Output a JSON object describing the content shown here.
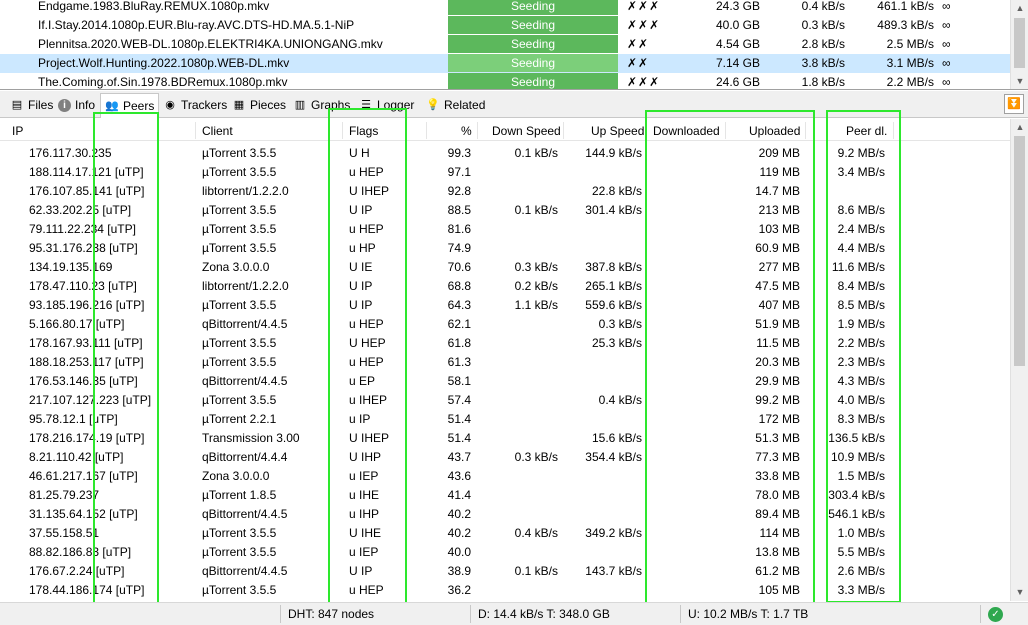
{
  "torrents": [
    {
      "name": "Endgame.1983.BluRay.REMUX.1080p.mkv",
      "status": "Seeding",
      "checks": "✗✗✗",
      "size": "24.3 GB",
      "up_speed": "0.4 kB/s",
      "down_speed": "461.1 kB/s",
      "eta": "∞"
    },
    {
      "name": "If.I.Stay.2014.1080p.EUR.Blu-ray.AVC.DTS-HD.MA.5.1-NiP",
      "status": "Seeding",
      "checks": "✗✗✗",
      "size": "40.0 GB",
      "up_speed": "0.3 kB/s",
      "down_speed": "489.3 kB/s",
      "eta": "∞"
    },
    {
      "name": "Plennitsa.2020.WEB-DL.1080p.ELEKTRI4KA.UNIONGANG.mkv",
      "status": "Seeding",
      "checks": "✗✗",
      "size": "4.54 GB",
      "up_speed": "2.8 kB/s",
      "down_speed": "2.5 MB/s",
      "eta": "∞"
    },
    {
      "name": "Project.Wolf.Hunting.2022.1080p.WEB-DL.mkv",
      "status": "Seeding",
      "checks": "✗✗",
      "size": "7.14 GB",
      "up_speed": "3.8 kB/s",
      "down_speed": "3.1 MB/s",
      "eta": "∞",
      "selected": true
    },
    {
      "name": "The.Coming.of.Sin.1978.BDRemux.1080p.mkv",
      "status": "Seeding",
      "checks": "✗✗✗",
      "size": "24.6 GB",
      "up_speed": "1.8 kB/s",
      "down_speed": "2.2 MB/s",
      "eta": "∞"
    }
  ],
  "tabs": [
    {
      "label": "Files",
      "icon": "file-icon"
    },
    {
      "label": "Info",
      "icon": "info-icon"
    },
    {
      "label": "Peers",
      "icon": "peers-icon",
      "active": true
    },
    {
      "label": "Trackers",
      "icon": "tracker-icon"
    },
    {
      "label": "Pieces",
      "icon": "pieces-icon"
    },
    {
      "label": "Graphs",
      "icon": "graph-icon"
    },
    {
      "label": "Logger",
      "icon": "logger-icon"
    },
    {
      "label": "Related",
      "icon": "bulb-icon"
    }
  ],
  "peer_columns": {
    "ip": "IP",
    "client": "Client",
    "flags": "Flags",
    "pct": "%",
    "down_speed": "Down Speed",
    "up_speed": "Up Speed",
    "downloaded": "Downloaded",
    "uploaded": "Uploaded",
    "peer_dl": "Peer dl."
  },
  "peers": [
    {
      "ip": "176.117.30.235",
      "client": "µTorrent 3.5.5",
      "flags": "U H",
      "pct": "99.3",
      "down": "0.1 kB/s",
      "up": "144.9 kB/s",
      "dl": "",
      "ul": "209 MB",
      "peer_dl": "9.2 MB/s"
    },
    {
      "ip": "188.114.17.121 [uTP]",
      "client": "µTorrent 3.5.5",
      "flags": "u HEP",
      "pct": "97.1",
      "down": "",
      "up": "",
      "dl": "",
      "ul": "119 MB",
      "peer_dl": "3.4 MB/s"
    },
    {
      "ip": "176.107.85.141 [uTP]",
      "client": "libtorrent/1.2.2.0",
      "flags": "U IHEP",
      "pct": "92.8",
      "down": "",
      "up": "22.8 kB/s",
      "dl": "",
      "ul": "14.7 MB",
      "peer_dl": ""
    },
    {
      "ip": "62.33.202.25 [uTP]",
      "client": "µTorrent 3.5.5",
      "flags": "U IP",
      "pct": "88.5",
      "down": "0.1 kB/s",
      "up": "301.4 kB/s",
      "dl": "",
      "ul": "213 MB",
      "peer_dl": "8.6 MB/s"
    },
    {
      "ip": "79.111.22.234 [uTP]",
      "client": "µTorrent 3.5.5",
      "flags": "u HEP",
      "pct": "81.6",
      "down": "",
      "up": "",
      "dl": "",
      "ul": "103 MB",
      "peer_dl": "2.4 MB/s"
    },
    {
      "ip": "95.31.176.238 [uTP]",
      "client": "µTorrent 3.5.5",
      "flags": "u HP",
      "pct": "74.9",
      "down": "",
      "up": "",
      "dl": "",
      "ul": "60.9 MB",
      "peer_dl": "4.4 MB/s"
    },
    {
      "ip": "134.19.135.169",
      "client": "Zona 3.0.0.0",
      "flags": "U IE",
      "pct": "70.6",
      "down": "0.3 kB/s",
      "up": "387.8 kB/s",
      "dl": "",
      "ul": "277 MB",
      "peer_dl": "11.6 MB/s"
    },
    {
      "ip": "178.47.110.23 [uTP]",
      "client": "libtorrent/1.2.2.0",
      "flags": "U IP",
      "pct": "68.8",
      "down": "0.2 kB/s",
      "up": "265.1 kB/s",
      "dl": "",
      "ul": "47.5 MB",
      "peer_dl": "8.4 MB/s"
    },
    {
      "ip": "93.185.196.216 [uTP]",
      "client": "µTorrent 3.5.5",
      "flags": "U IP",
      "pct": "64.3",
      "down": "1.1 kB/s",
      "up": "559.6 kB/s",
      "dl": "",
      "ul": "407 MB",
      "peer_dl": "8.5 MB/s"
    },
    {
      "ip": "5.166.80.17 [uTP]",
      "client": "qBittorrent/4.4.5",
      "flags": "u HEP",
      "pct": "62.1",
      "down": "",
      "up": "0.3 kB/s",
      "dl": "",
      "ul": "51.9 MB",
      "peer_dl": "1.9 MB/s"
    },
    {
      "ip": "178.167.93.111 [uTP]",
      "client": "µTorrent 3.5.5",
      "flags": "U HEP",
      "pct": "61.8",
      "down": "",
      "up": "25.3 kB/s",
      "dl": "",
      "ul": "11.5 MB",
      "peer_dl": "2.2 MB/s"
    },
    {
      "ip": "188.18.253.117 [uTP]",
      "client": "µTorrent 3.5.5",
      "flags": "u HEP",
      "pct": "61.3",
      "down": "",
      "up": "",
      "dl": "",
      "ul": "20.3 MB",
      "peer_dl": "2.3 MB/s"
    },
    {
      "ip": "176.53.146.35 [uTP]",
      "client": "qBittorrent/4.4.5",
      "flags": "u EP",
      "pct": "58.1",
      "down": "",
      "up": "",
      "dl": "",
      "ul": "29.9 MB",
      "peer_dl": "4.3 MB/s"
    },
    {
      "ip": "217.107.127.223 [uTP]",
      "client": "µTorrent 3.5.5",
      "flags": "u IHEP",
      "pct": "57.4",
      "down": "",
      "up": "0.4 kB/s",
      "dl": "",
      "ul": "99.2 MB",
      "peer_dl": "4.0 MB/s"
    },
    {
      "ip": "95.78.12.1 [uTP]",
      "client": "µTorrent 2.2.1",
      "flags": "u IP",
      "pct": "51.4",
      "down": "",
      "up": "",
      "dl": "",
      "ul": "172 MB",
      "peer_dl": "8.3 MB/s"
    },
    {
      "ip": "178.216.174.19 [uTP]",
      "client": "Transmission 3.00",
      "flags": "U IHEP",
      "pct": "51.4",
      "down": "",
      "up": "15.6 kB/s",
      "dl": "",
      "ul": "51.3 MB",
      "peer_dl": "136.5 kB/s"
    },
    {
      "ip": "8.21.110.42 [uTP]",
      "client": "qBittorrent/4.4.4",
      "flags": "U IHP",
      "pct": "43.7",
      "down": "0.3 kB/s",
      "up": "354.4 kB/s",
      "dl": "",
      "ul": "77.3 MB",
      "peer_dl": "10.9 MB/s"
    },
    {
      "ip": "46.61.217.167 [uTP]",
      "client": "Zona 3.0.0.0",
      "flags": "u IEP",
      "pct": "43.6",
      "down": "",
      "up": "",
      "dl": "",
      "ul": "33.8 MB",
      "peer_dl": "1.5 MB/s"
    },
    {
      "ip": "81.25.79.237",
      "client": "µTorrent 1.8.5",
      "flags": "u IHE",
      "pct": "41.4",
      "down": "",
      "up": "",
      "dl": "",
      "ul": "78.0 MB",
      "peer_dl": "303.4 kB/s"
    },
    {
      "ip": "31.135.64.152 [uTP]",
      "client": "qBittorrent/4.4.5",
      "flags": "u IHP",
      "pct": "40.2",
      "down": "",
      "up": "",
      "dl": "",
      "ul": "89.4 MB",
      "peer_dl": "546.1 kB/s"
    },
    {
      "ip": "37.55.158.51",
      "client": "µTorrent 3.5.5",
      "flags": "U IHE",
      "pct": "40.2",
      "down": "0.4 kB/s",
      "up": "349.2 kB/s",
      "dl": "",
      "ul": "114 MB",
      "peer_dl": "1.0 MB/s"
    },
    {
      "ip": "88.82.186.83 [uTP]",
      "client": "µTorrent 3.5.5",
      "flags": "u IEP",
      "pct": "40.0",
      "down": "",
      "up": "",
      "dl": "",
      "ul": "13.8 MB",
      "peer_dl": "5.5 MB/s"
    },
    {
      "ip": "176.67.2.24 [uTP]",
      "client": "qBittorrent/4.4.5",
      "flags": "U IP",
      "pct": "38.9",
      "down": "0.1 kB/s",
      "up": "143.7 kB/s",
      "dl": "",
      "ul": "61.2 MB",
      "peer_dl": "2.6 MB/s"
    },
    {
      "ip": "178.44.186.174 [uTP]",
      "client": "µTorrent 3.5.5",
      "flags": "u HEP",
      "pct": "36.2",
      "down": "",
      "up": "",
      "dl": "",
      "ul": "105 MB",
      "peer_dl": "3.3 MB/s"
    }
  ],
  "statusbar": {
    "dht": "DHT: 847 nodes",
    "download": "D: 14.4 kB/s T: 348.0 GB",
    "upload": "U: 10.2 MB/s T: 1.7 TB"
  },
  "colors": {
    "seeding": "#5cb85c",
    "selected_row": "#cce8ff",
    "highlight": "#2de82d",
    "ok_icon": "#2fa84f"
  }
}
